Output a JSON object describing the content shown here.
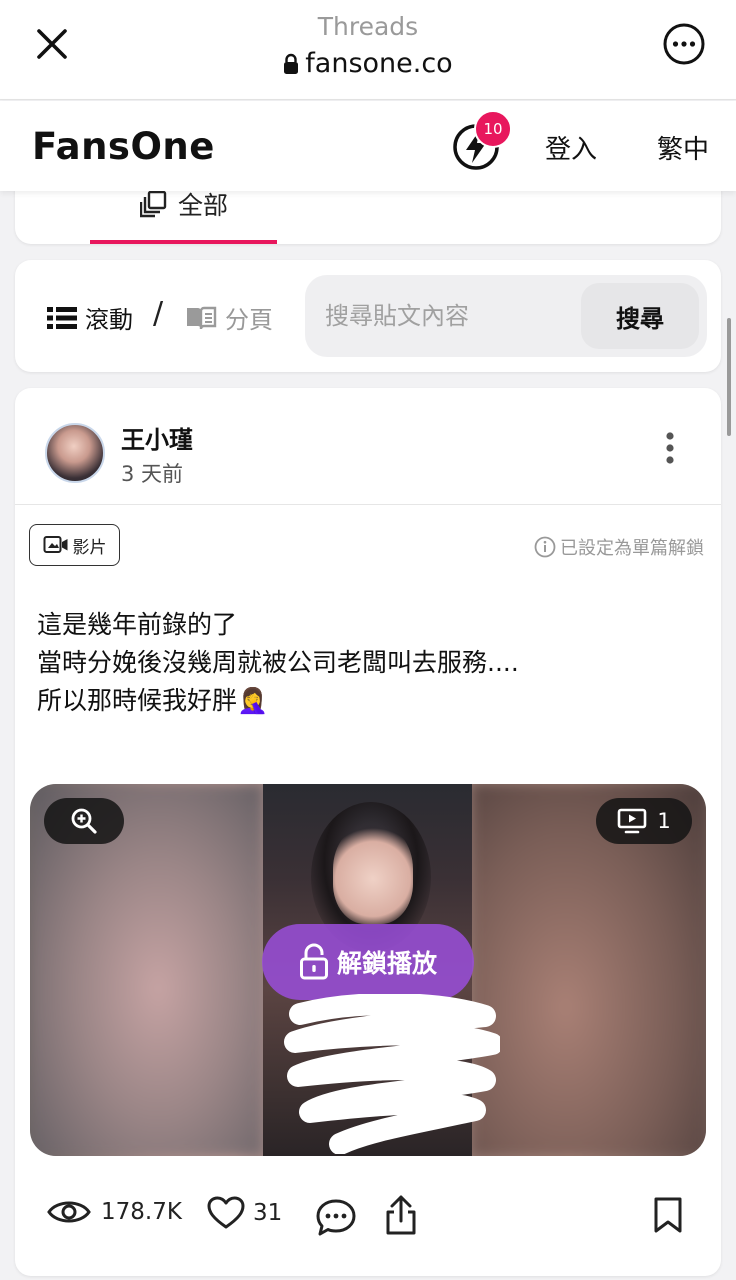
{
  "browser": {
    "title": "Threads",
    "url": "fansone.co",
    "close_icon": "close-icon",
    "more_icon": "more-horizontal-icon"
  },
  "header": {
    "logo": "FansOne",
    "notification_count": "10",
    "login": "登入",
    "language": "繁中",
    "accent_color": "#e8175d"
  },
  "tabs": {
    "active": "全部"
  },
  "toolbar": {
    "mode_scroll": "滾動",
    "separator": "/",
    "mode_page": "分頁",
    "search_placeholder": "搜尋貼文內容",
    "search_button": "搜尋"
  },
  "post": {
    "author": "王小瑾",
    "time": "3 天前",
    "type_badge": "影片",
    "unlock_note": "已設定為單篇解鎖",
    "text_lines": [
      "這是幾年前錄的了",
      "當時分娩後沒幾周就被公司老闆叫去服務....",
      "所以那時候我好胖🤦‍♀️"
    ],
    "media": {
      "count": "1",
      "unlock_button": "解鎖播放",
      "unlock_color": "#974dd6"
    },
    "stats": {
      "views": "178.7K",
      "likes": "31"
    }
  }
}
